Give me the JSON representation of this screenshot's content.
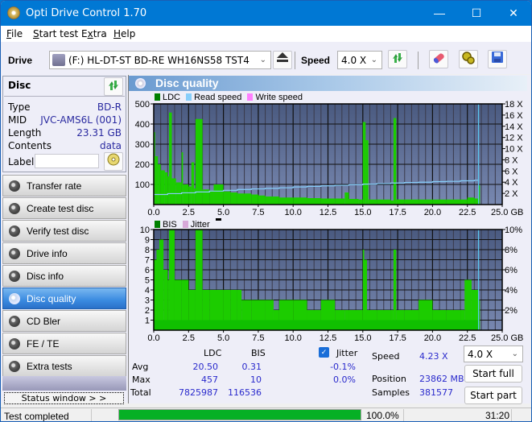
{
  "window": {
    "title": "Opti Drive Control 1.70",
    "controls": {
      "minimize": "—",
      "maximize": "☐",
      "close": "✕"
    }
  },
  "menu": [
    "File",
    "Start test",
    "Extra",
    "Help"
  ],
  "menu_underline": [
    "F",
    "S",
    "x",
    "H"
  ],
  "toolbar": {
    "drive_label": "Drive",
    "drive_value": "(F:)  HL-DT-ST BD-RE  WH16NS58 TST4",
    "speed_label": "Speed",
    "speed_value": "4.0 X",
    "icons": [
      "eject-icon",
      "refresh-icon",
      "erase-icon",
      "settings-icon",
      "save-icon"
    ]
  },
  "disc": {
    "header": "Disc",
    "rows": [
      {
        "label": "Type",
        "value": "BD-R"
      },
      {
        "label": "MID",
        "value": "JVC-AMS6L (001)"
      },
      {
        "label": "Length",
        "value": "23.31 GB"
      },
      {
        "label": "Contents",
        "value": "data"
      }
    ],
    "label_field_label": "Label",
    "label_field_value": ""
  },
  "nav": [
    {
      "label": "Transfer rate",
      "active": false
    },
    {
      "label": "Create test disc",
      "active": false
    },
    {
      "label": "Verify test disc",
      "active": false
    },
    {
      "label": "Drive info",
      "active": false
    },
    {
      "label": "Disc info",
      "active": false
    },
    {
      "label": "Disc quality",
      "active": true
    },
    {
      "label": "CD Bler",
      "active": false
    },
    {
      "label": "FE / TE",
      "active": false
    },
    {
      "label": "Extra tests",
      "active": false
    }
  ],
  "status_window_button": "Status window > >",
  "panel_title": "Disc quality",
  "colors": {
    "ldc": "#008000",
    "read_speed": "#87cefa",
    "write_speed": "#ff80ff",
    "bis": "#008000",
    "jitter": "#d8a8d8",
    "bars": "#00cc00",
    "plot_bg_top": "#4a5a80",
    "plot_bg_bottom": "#7080a8",
    "progress": "#06b025",
    "value_text": "#2a2acc"
  },
  "chart_data": [
    {
      "type": "bar",
      "title": "LDC",
      "legend": [
        "LDC",
        "Read speed",
        "Write speed"
      ],
      "legend_placement": "top-left",
      "xlabel": "GB",
      "xlim": [
        0,
        25
      ],
      "x_ticks": [
        "0.0",
        "2.5",
        "5.0",
        "7.5",
        "10.0",
        "12.5",
        "15.0",
        "17.5",
        "20.0",
        "22.5",
        "25.0 GB"
      ],
      "ylim": [
        0,
        500
      ],
      "y_ticks": [
        "500",
        "400",
        "300",
        "200",
        "100"
      ],
      "y2lim": [
        0,
        18
      ],
      "y2_ticks": [
        "18 X",
        "16 X",
        "14 X",
        "12 X",
        "10 X",
        "8 X",
        "6 X",
        "4 X",
        "2 X"
      ],
      "grid": true,
      "ldc_x": [
        0.0,
        0.1,
        0.3,
        0.5,
        0.8,
        1.0,
        1.1,
        1.3,
        1.6,
        2.0,
        2.1,
        2.5,
        2.7,
        2.9,
        3.0,
        3.5,
        4.0,
        4.3,
        5.0,
        5.5,
        6.0,
        7.0,
        7.5,
        8.0,
        9.0,
        10.0,
        11.0,
        12.0,
        13.0,
        13.7,
        14.0,
        14.7,
        15.0,
        15.2,
        15.4,
        16.0,
        17.0,
        17.2,
        17.4,
        18.0,
        19.0,
        20.0,
        21.0,
        22.0,
        22.5,
        23.0,
        23.3
      ],
      "ldc_y": [
        360,
        240,
        200,
        170,
        160,
        140,
        457,
        130,
        110,
        260,
        100,
        90,
        210,
        80,
        425,
        75,
        70,
        100,
        65,
        60,
        55,
        50,
        45,
        40,
        35,
        35,
        32,
        30,
        30,
        60,
        28,
        25,
        410,
        320,
        25,
        25,
        20,
        430,
        25,
        25,
        25,
        25,
        25,
        25,
        35,
        30,
        95
      ],
      "read_speed_x": [
        0.0,
        1.0,
        2.0,
        3.0,
        4.0,
        5.0,
        6.0,
        7.0,
        8.0,
        9.0,
        10.0,
        11.0,
        12.0,
        13.0,
        14.0,
        15.0,
        16.0,
        17.0,
        18.0,
        19.0,
        20.0,
        21.0,
        22.0,
        23.0,
        23.3
      ],
      "read_speed_y": [
        1.8,
        1.95,
        2.1,
        2.25,
        2.4,
        2.55,
        2.7,
        2.8,
        2.9,
        3.0,
        3.15,
        3.25,
        3.35,
        3.45,
        3.55,
        3.65,
        3.75,
        3.85,
        3.95,
        4.0,
        4.1,
        4.15,
        4.25,
        4.35,
        4.4
      ]
    },
    {
      "type": "bar",
      "title": "BIS",
      "legend": [
        "BIS",
        "Jitter"
      ],
      "legend_placement": "top-left",
      "xlabel": "GB",
      "xlim": [
        0,
        25
      ],
      "x_ticks": [
        "0.0",
        "2.5",
        "5.0",
        "7.5",
        "10.0",
        "12.5",
        "15.0",
        "17.5",
        "20.0",
        "22.5",
        "25.0 GB"
      ],
      "ylim": [
        0,
        10
      ],
      "y_ticks": [
        "10",
        "9",
        "8",
        "7",
        "6",
        "5",
        "4",
        "3",
        "2",
        "1"
      ],
      "y2lim": [
        0,
        10
      ],
      "y2_ticks": [
        "10%",
        "8%",
        "6%",
        "4%",
        "2%"
      ],
      "grid": true,
      "bis_x": [
        0.0,
        0.2,
        0.4,
        0.7,
        1.0,
        1.1,
        1.5,
        2.0,
        2.5,
        3.0,
        3.5,
        4.0,
        5.0,
        5.5,
        6.0,
        6.3,
        7.0,
        8.0,
        8.6,
        9.0,
        10.0,
        11.0,
        12.0,
        13.0,
        13.7,
        14.0,
        15.0,
        15.1,
        15.3,
        16.0,
        17.0,
        17.2,
        17.4,
        18.0,
        19.0,
        20.0,
        21.0,
        22.0,
        22.3,
        22.8,
        23.3
      ],
      "bis_y": [
        7,
        8,
        9,
        6,
        5,
        10,
        5,
        5,
        4,
        10,
        4,
        4,
        4,
        4,
        4,
        3,
        3,
        3,
        2,
        3,
        3,
        2,
        3,
        2,
        2,
        2,
        8,
        7,
        2,
        2,
        2,
        8,
        2,
        2,
        3,
        2,
        2,
        2,
        5,
        4,
        3
      ]
    }
  ],
  "stats": {
    "col_ldc": "LDC",
    "col_bis": "BIS",
    "rows": [
      {
        "label": "Avg",
        "ldc": "20.50",
        "bis": "0.31"
      },
      {
        "label": "Max",
        "ldc": "457",
        "bis": "10"
      },
      {
        "label": "Total",
        "ldc": "7825987",
        "bis": "116536"
      }
    ],
    "jitter_checked": true,
    "jitter_label": "Jitter",
    "jitter_avg": "-0.1%",
    "jitter_max": "0.0%",
    "speed_label": "Speed",
    "speed_value": "4.23 X",
    "position_label": "Position",
    "position_value": "23862 MB",
    "samples_label": "Samples",
    "samples_value": "381577",
    "speed_select": "4.0 X",
    "start_full": "Start full",
    "start_part": "Start part"
  },
  "statusbar": {
    "text": "Test completed",
    "progress_percent": 100.0,
    "progress_text": "100.0%",
    "time": "31:20"
  }
}
